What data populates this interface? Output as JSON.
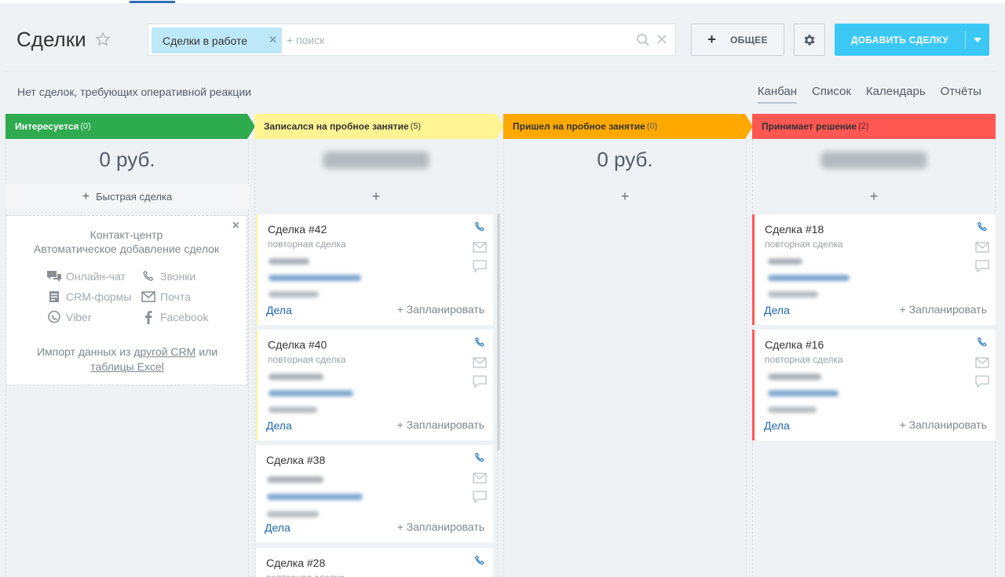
{
  "header": {
    "title": "Сделки",
    "filter_chip": "Сделки в работе",
    "search_placeholder": "+ поиск",
    "general_button": "ОБЩЕЕ",
    "add_button": "ДОБАВИТЬ СДЕЛКУ",
    "notice": "Нет сделок, требующих оперативной реакции"
  },
  "views": [
    "Канбан",
    "Список",
    "Календарь",
    "Отчёты"
  ],
  "active_view": "Канбан",
  "columns": [
    {
      "title": "Интересуется",
      "count": "(0)",
      "color": "#2fab4f",
      "text_color": "#ffffff",
      "sum": "0 руб.",
      "quick_deal": "Быстрая сделка"
    },
    {
      "title": "Записался на пробное занятие",
      "count": "(5)",
      "color": "#fff493",
      "text_color": "#333333",
      "add": "+"
    },
    {
      "title": "Пришел на пробное занятие",
      "count": "(0)",
      "color": "#ffa900",
      "text_color": "#333333",
      "sum": "0 руб.",
      "add": "+"
    },
    {
      "title": "Принимает решение",
      "count": "(2)",
      "color": "#ff5752",
      "text_color": "#333333",
      "add": "+"
    }
  ],
  "contact_center": {
    "title": "Контакт-центр",
    "subtitle": "Автоматическое добавление сделок",
    "channels": [
      "Онлайн-чат",
      "Звонки",
      "CRM-формы",
      "Почта",
      "Viber",
      "Facebook"
    ],
    "import_prefix": "Импорт данных из",
    "import_link1": "другой CRM",
    "import_mid": "или",
    "import_link2": "таблицы Excel"
  },
  "card_common": {
    "type": "повторная сделка",
    "deals_link": "Дела",
    "plan_link": "+ Запланировать"
  },
  "cards_col2": [
    {
      "title": "Сделка #42",
      "show_type": true
    },
    {
      "title": "Сделка #40",
      "show_type": true
    },
    {
      "title": "Сделка #38",
      "show_type": false
    },
    {
      "title": "Сделка #28",
      "show_type": true
    }
  ],
  "cards_col4": [
    {
      "title": "Сделка #18"
    },
    {
      "title": "Сделка #16"
    }
  ],
  "colors": {
    "accent": "#3bc8f5",
    "link": "#2067b0",
    "phone_icon": "#2a7ec0"
  }
}
